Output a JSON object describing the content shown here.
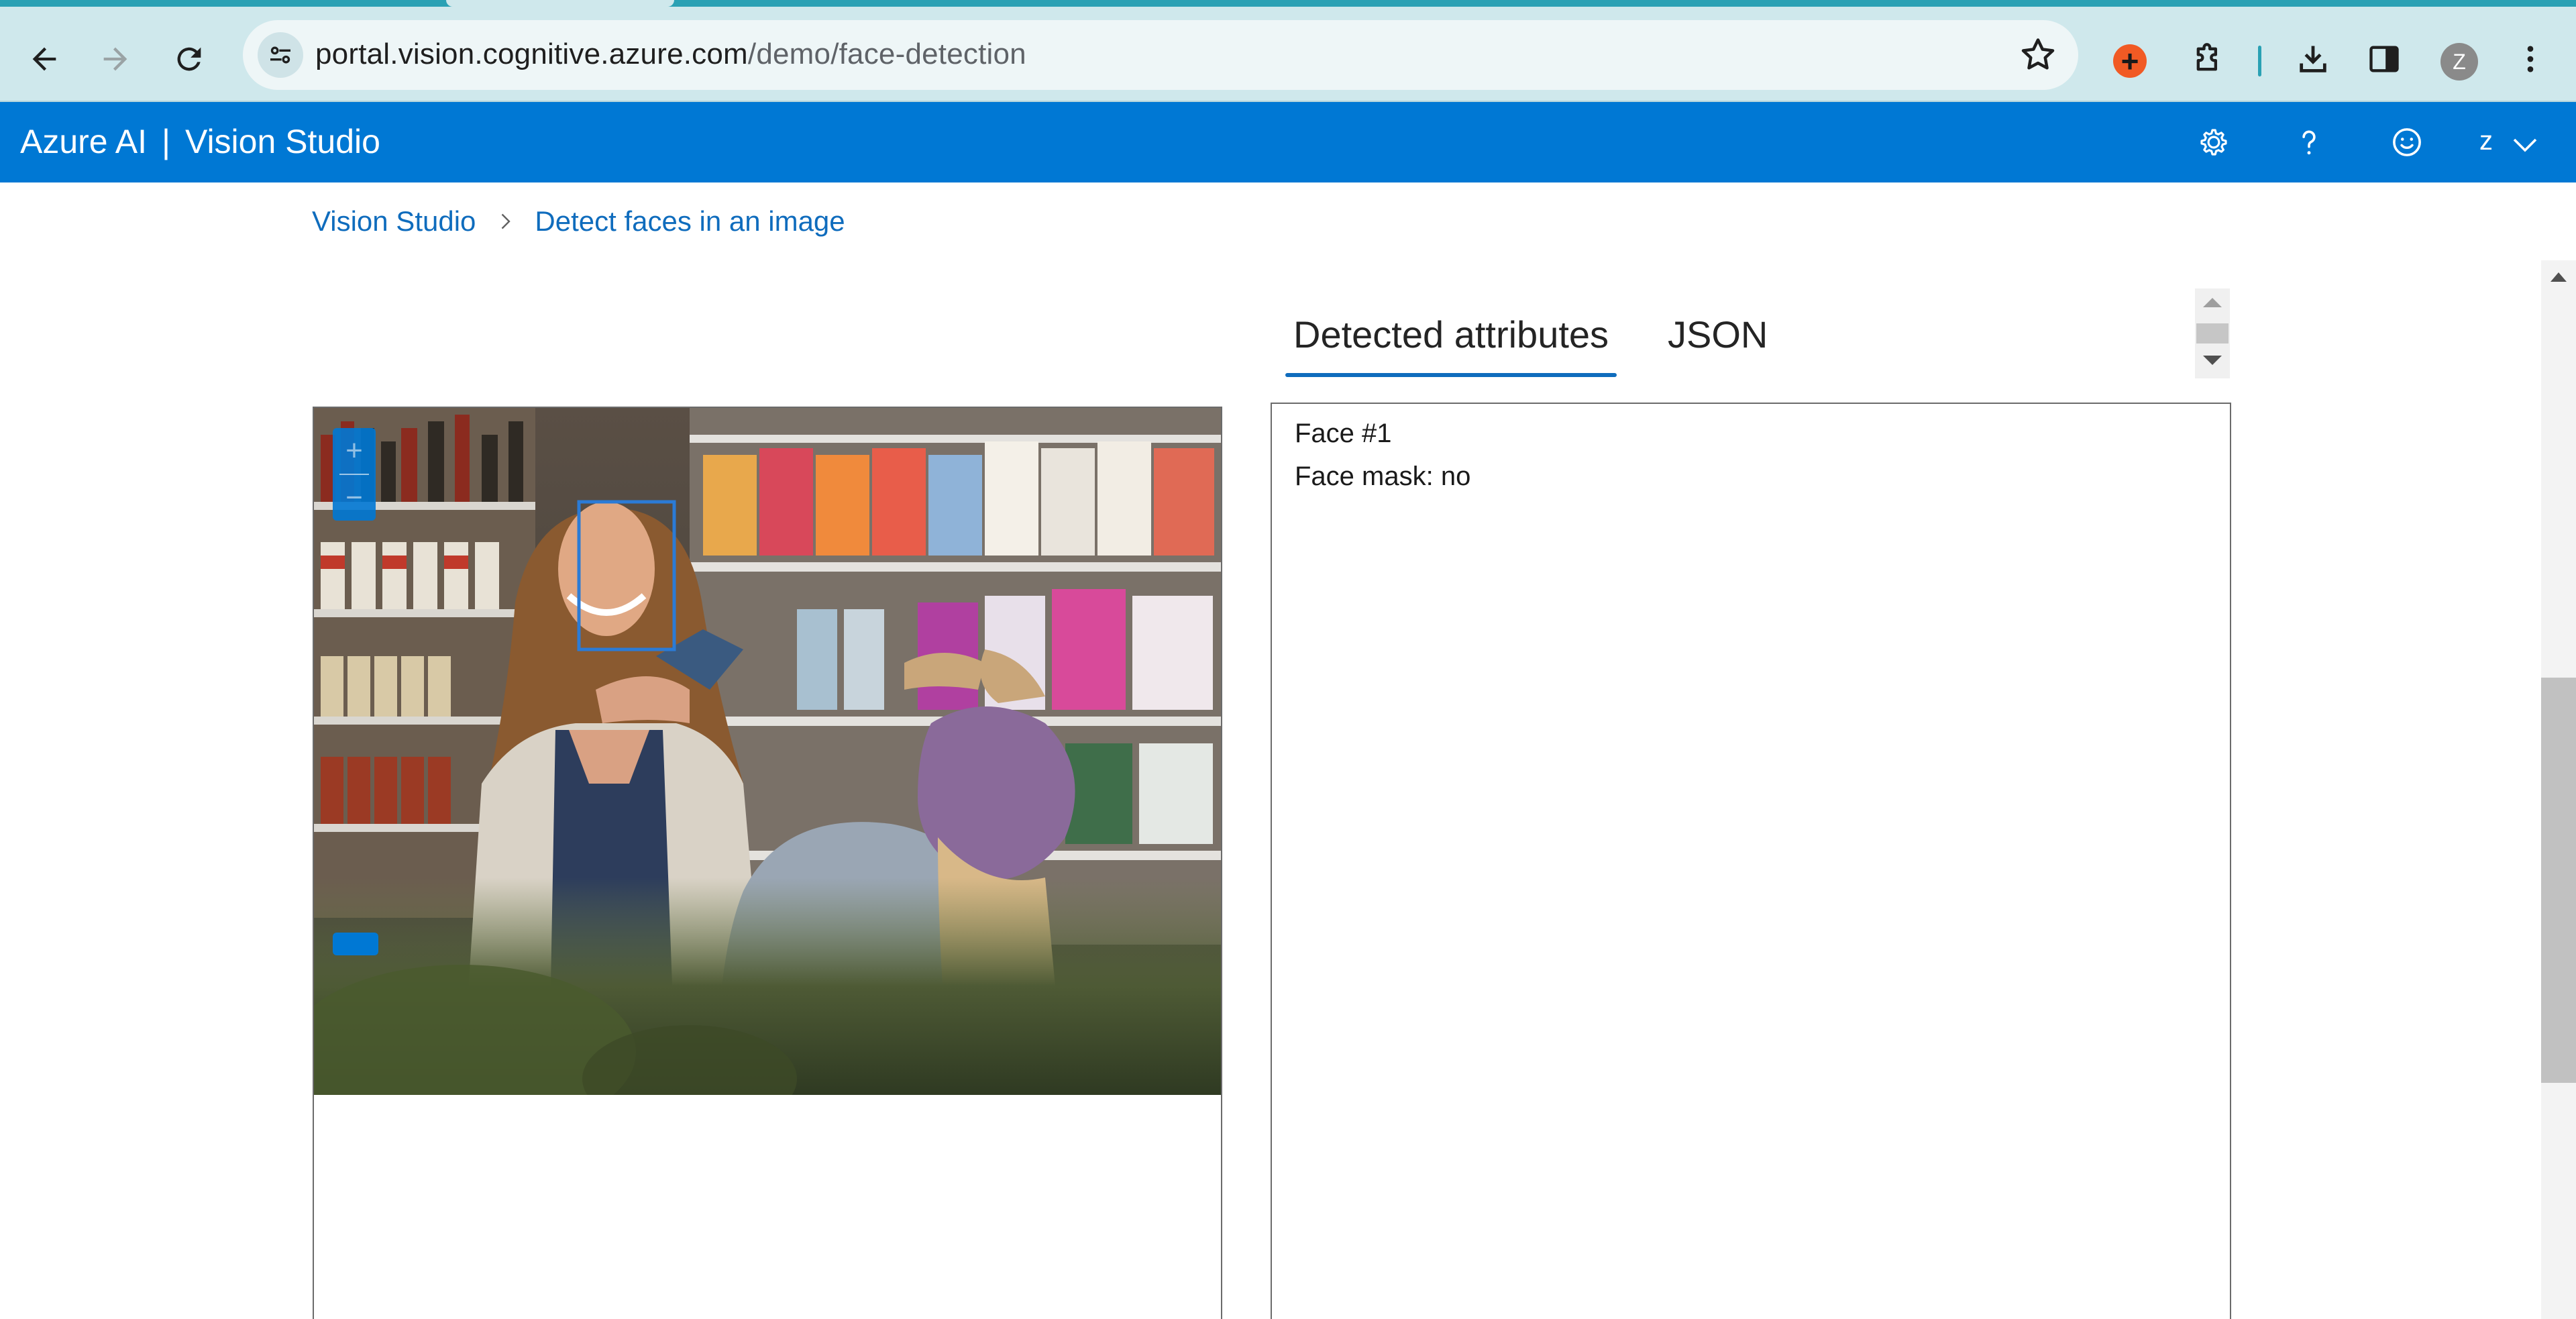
{
  "browser": {
    "url_host": "portal.vision.cognitive.azure.com",
    "url_path": "/demo/face-detection",
    "profile_initial": "Z",
    "icons": [
      "back-icon",
      "forward-icon",
      "reload-icon",
      "site-info-icon",
      "bookmark-star-icon",
      "extension-red-icon",
      "extensions-puzzle-icon",
      "downloads-icon",
      "side-panel-icon",
      "profile-avatar",
      "menu-kebab-icon"
    ]
  },
  "header": {
    "brand": "Azure AI",
    "separator": "|",
    "product": "Vision Studio",
    "user_initial": "z",
    "icons": [
      "settings-gear-icon",
      "help-question-icon",
      "feedback-smiley-icon",
      "chevron-down-icon"
    ],
    "bg_color": "#0078d4"
  },
  "breadcrumb": {
    "root": "Vision Studio",
    "current": "Detect faces in an image"
  },
  "tabs": {
    "active": "Detected attributes",
    "json": "JSON"
  },
  "image_viewer": {
    "zoom_in": "+",
    "zoom_out": "−"
  },
  "results": {
    "face_label": "Face #1",
    "face_mask": "Face mask: no"
  },
  "colors": {
    "accent": "#0f6cbd",
    "face_box": "#2b7bd6"
  }
}
